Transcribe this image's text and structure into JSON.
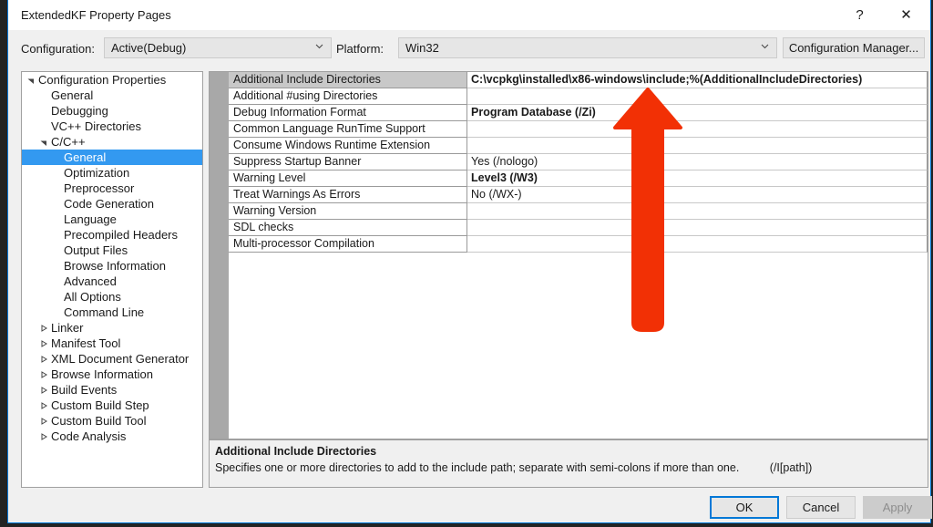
{
  "window": {
    "title": "ExtendedKF Property Pages",
    "help_glyph": "?",
    "close_glyph": "✕",
    "accent_color": "#0078d7"
  },
  "config_bar": {
    "configuration_label": "Configuration:",
    "configuration_value": "Active(Debug)",
    "platform_label": "Platform:",
    "platform_value": "Win32",
    "configuration_manager_label": "Configuration Manager..."
  },
  "tree": {
    "items": [
      {
        "label": "Configuration Properties",
        "level": 0,
        "expander": "down",
        "selected": false
      },
      {
        "label": "General",
        "level": 1,
        "expander": "none",
        "selected": false
      },
      {
        "label": "Debugging",
        "level": 1,
        "expander": "none",
        "selected": false
      },
      {
        "label": "VC++ Directories",
        "level": 1,
        "expander": "none",
        "selected": false
      },
      {
        "label": "C/C++",
        "level": 1,
        "expander": "down",
        "selected": false
      },
      {
        "label": "General",
        "level": 2,
        "expander": "none",
        "selected": true
      },
      {
        "label": "Optimization",
        "level": 2,
        "expander": "none",
        "selected": false
      },
      {
        "label": "Preprocessor",
        "level": 2,
        "expander": "none",
        "selected": false
      },
      {
        "label": "Code Generation",
        "level": 2,
        "expander": "none",
        "selected": false
      },
      {
        "label": "Language",
        "level": 2,
        "expander": "none",
        "selected": false
      },
      {
        "label": "Precompiled Headers",
        "level": 2,
        "expander": "none",
        "selected": false
      },
      {
        "label": "Output Files",
        "level": 2,
        "expander": "none",
        "selected": false
      },
      {
        "label": "Browse Information",
        "level": 2,
        "expander": "none",
        "selected": false
      },
      {
        "label": "Advanced",
        "level": 2,
        "expander": "none",
        "selected": false
      },
      {
        "label": "All Options",
        "level": 2,
        "expander": "none",
        "selected": false
      },
      {
        "label": "Command Line",
        "level": 2,
        "expander": "none",
        "selected": false
      },
      {
        "label": "Linker",
        "level": 1,
        "expander": "right",
        "selected": false
      },
      {
        "label": "Manifest Tool",
        "level": 1,
        "expander": "right",
        "selected": false
      },
      {
        "label": "XML Document Generator",
        "level": 1,
        "expander": "right",
        "selected": false
      },
      {
        "label": "Browse Information",
        "level": 1,
        "expander": "right",
        "selected": false
      },
      {
        "label": "Build Events",
        "level": 1,
        "expander": "right",
        "selected": false
      },
      {
        "label": "Custom Build Step",
        "level": 1,
        "expander": "right",
        "selected": false
      },
      {
        "label": "Custom Build Tool",
        "level": 1,
        "expander": "right",
        "selected": false
      },
      {
        "label": "Code Analysis",
        "level": 1,
        "expander": "right",
        "selected": false
      }
    ]
  },
  "grid": {
    "rows": [
      {
        "name": "Additional Include Directories",
        "value": "C:\\vcpkg\\installed\\x86-windows\\include;%(AdditionalIncludeDirectories)",
        "bold": true,
        "selected": true
      },
      {
        "name": "Additional #using Directories",
        "value": "",
        "bold": false,
        "selected": false
      },
      {
        "name": "Debug Information Format",
        "value": "Program Database (/Zi)",
        "bold": true,
        "selected": false
      },
      {
        "name": "Common Language RunTime Support",
        "value": "",
        "bold": false,
        "selected": false
      },
      {
        "name": "Consume Windows Runtime Extension",
        "value": "",
        "bold": false,
        "selected": false
      },
      {
        "name": "Suppress Startup Banner",
        "value": "Yes (/nologo)",
        "bold": false,
        "selected": false
      },
      {
        "name": "Warning Level",
        "value": "Level3 (/W3)",
        "bold": true,
        "selected": false
      },
      {
        "name": "Treat Warnings As Errors",
        "value": "No (/WX-)",
        "bold": false,
        "selected": false
      },
      {
        "name": "Warning Version",
        "value": "",
        "bold": false,
        "selected": false
      },
      {
        "name": "SDL checks",
        "value": "",
        "bold": false,
        "selected": false
      },
      {
        "name": "Multi-processor Compilation",
        "value": "",
        "bold": false,
        "selected": false
      }
    ]
  },
  "description": {
    "title": "Additional Include Directories",
    "body": "Specifies one or more directories to add to the include path; separate with semi-colons if more than one.",
    "switch": "(/I[path])"
  },
  "footer": {
    "ok_label": "OK",
    "cancel_label": "Cancel",
    "apply_label": "Apply"
  },
  "annotation": {
    "arrow_color": "#f23005",
    "direction": "up"
  }
}
